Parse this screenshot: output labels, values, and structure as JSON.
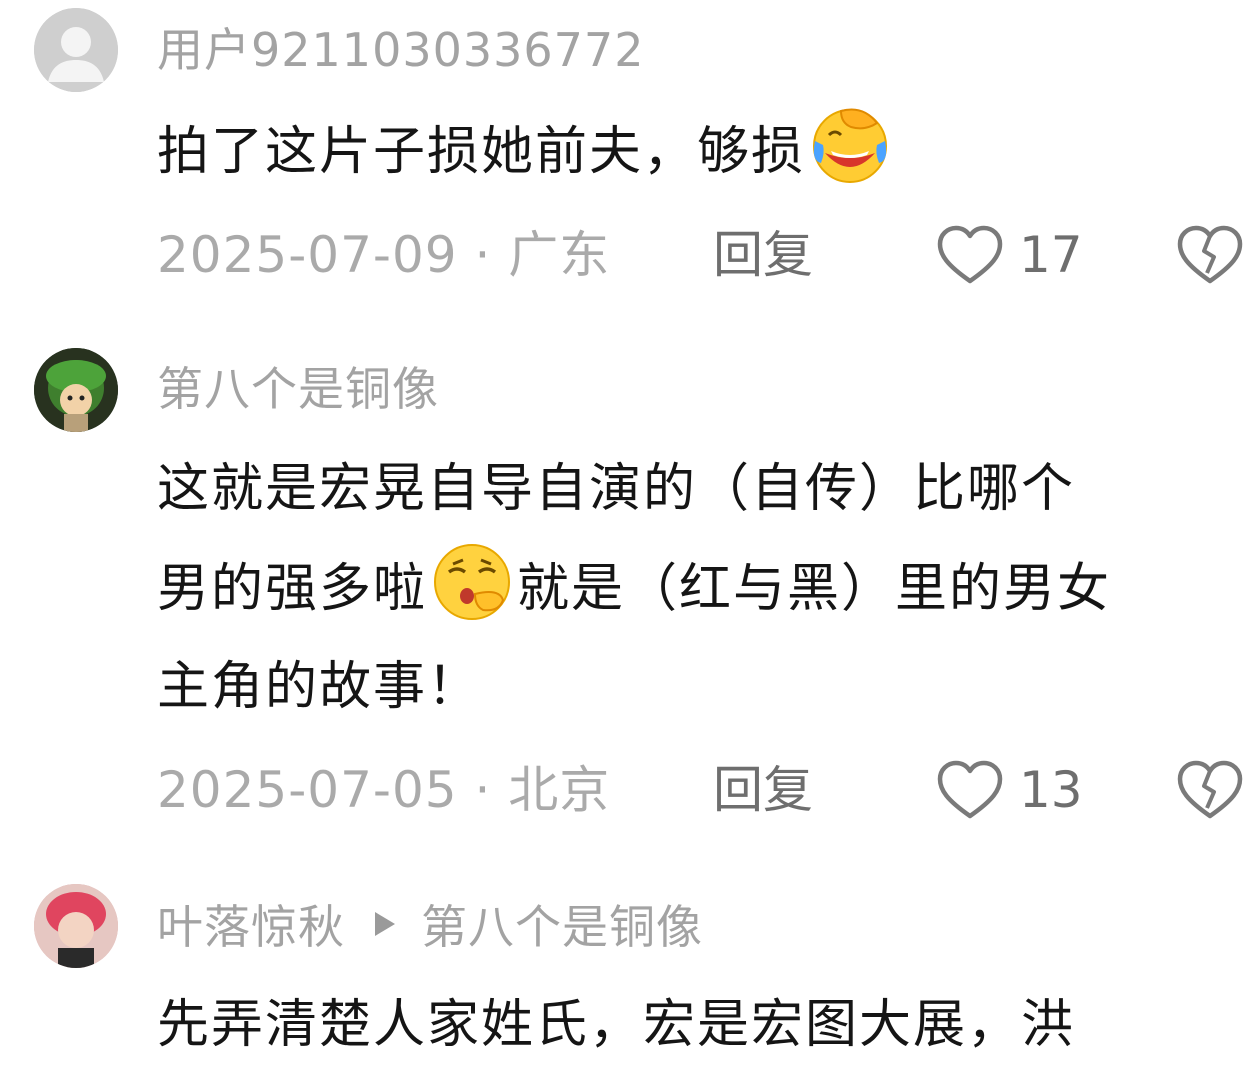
{
  "comments": [
    {
      "username": "用户9211030336772",
      "text_before_emoji": "拍了这片子损她前夫，够损",
      "emoji": "rolling-laughing-emoji",
      "date": "2025-07-09",
      "separator": "·",
      "location": "广东",
      "reply_label": "回复",
      "likes": "17"
    },
    {
      "username": "第八个是铜像",
      "line1": "这就是宏晃自导自演的（自传）比哪个",
      "line2_before_emoji": "男的强多啦",
      "emoji": "thinking-face-emoji",
      "line2_after_emoji": "就是（红与黑）里的男女",
      "line3": "主角的故事！",
      "date": "2025-07-05",
      "separator": "·",
      "location": "北京",
      "reply_label": "回复",
      "likes": "13"
    },
    {
      "username": "叶落惊秋",
      "reply_to": "第八个是铜像",
      "line1": "先弄清楚人家姓氏，宏是宏图大展，洪"
    }
  ],
  "icons": {
    "like": "heart-outline-icon",
    "dislike": "broken-heart-icon",
    "reply_arrow": "play-triangle-icon",
    "default_avatar": "default-user-avatar"
  },
  "colors": {
    "text": "#151515",
    "meta": "#aaaaaa",
    "action": "#6e6e6e",
    "background": "#ffffff"
  }
}
